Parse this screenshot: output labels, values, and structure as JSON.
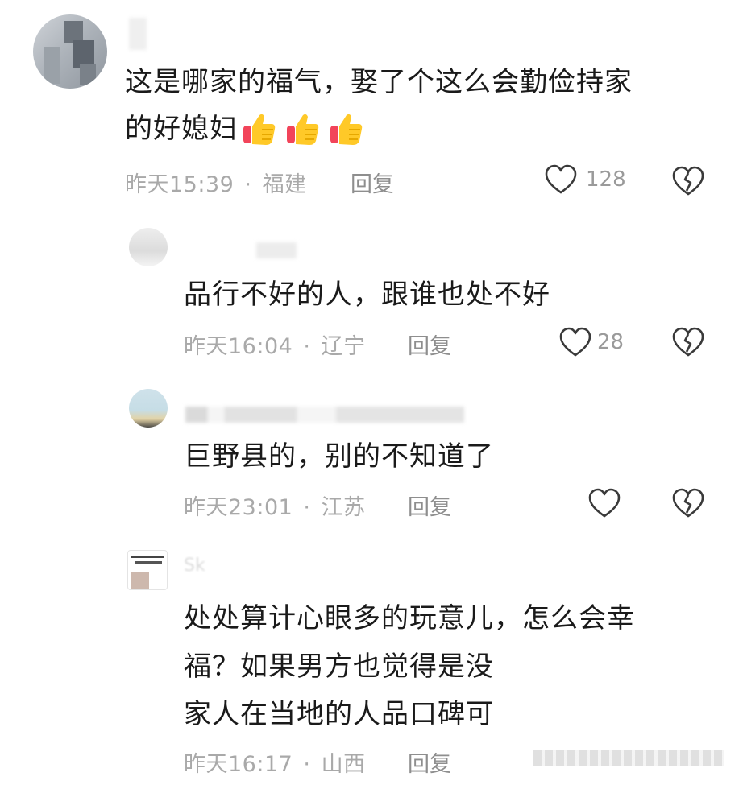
{
  "comments": [
    {
      "text_lines": [
        "这是哪家的福气，娶了个这么会勤俭持家",
        "的好媳妇"
      ],
      "emoji": [
        "thumbs-up",
        "thumbs-up",
        "thumbs-up"
      ],
      "time": "昨天15:39",
      "sep": "·",
      "location": "福建",
      "reply_label": "回复",
      "likes": "128"
    },
    {
      "text_lines": [
        "品行不好的人，跟谁也处不好"
      ],
      "time": "昨天16:04",
      "sep": "·",
      "location": "辽宁",
      "reply_label": "回复",
      "likes": "28"
    },
    {
      "text_lines": [
        "巨野县的，别的不知道了"
      ],
      "time": "昨天23:01",
      "sep": "·",
      "location": "江苏",
      "reply_label": "回复",
      "likes": ""
    },
    {
      "name_partial": "Sk",
      "text_lines": [
        "处处算计心眼多的玩意儿，怎么会幸",
        "福？如果男方也觉得是没",
        "家人在当地的人品口碑可"
      ],
      "time": "昨天16:17",
      "sep": "·",
      "location": "山西",
      "reply_label": "回复"
    }
  ],
  "icons": {
    "like": "heart-outline-icon",
    "dislike": "broken-heart-icon"
  },
  "colors": {
    "text": "#1a1a1a",
    "meta": "#a9a9a9",
    "emoji_yellow": "#ffc928",
    "emoji_red": "#f2445a"
  }
}
